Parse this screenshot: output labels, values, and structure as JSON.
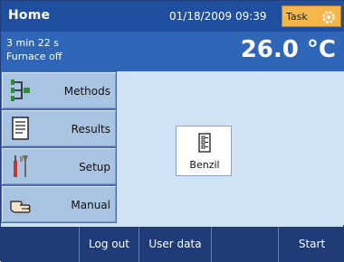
{
  "header": {
    "title": "Home",
    "datetime": "01/18/2009 09:39",
    "task_label": "Task",
    "task_icon": "gear-icon",
    "colors": {
      "header_bg": "#1f4f9e",
      "task_bg": "#f6b74a"
    }
  },
  "status": {
    "time_remaining": "3 min 22 s",
    "furnace": "Furnace off",
    "temperature": "26.0 °C"
  },
  "menu": {
    "items": [
      {
        "label": "Methods",
        "icon": "methods-icon"
      },
      {
        "label": "Results",
        "icon": "results-icon"
      },
      {
        "label": "Setup",
        "icon": "tools-icon"
      },
      {
        "label": "Manual",
        "icon": "hand-icon"
      }
    ]
  },
  "content": {
    "shortcut": {
      "label": "Benzil",
      "icon": "method-document-icon"
    }
  },
  "footer": {
    "logout_label": "Log out",
    "userdata_label": "User data",
    "start_label": "Start"
  }
}
